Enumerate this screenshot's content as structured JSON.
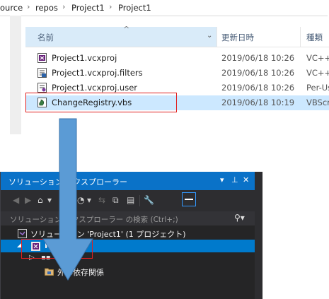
{
  "explorer": {
    "breadcrumb": [
      "ource",
      "repos",
      "Project1",
      "Project1"
    ],
    "columns": {
      "name": "名前",
      "date": "更新日時",
      "type": "種類"
    },
    "files": [
      {
        "name": "Project1.vcxproj",
        "date": "2019/06/18 10:26",
        "type": "VC++",
        "icon": "vcxproj-file-icon"
      },
      {
        "name": "Project1.vcxproj.filters",
        "date": "2019/06/18 10:26",
        "type": "VC++",
        "icon": "filters-file-icon"
      },
      {
        "name": "Project1.vcxproj.user",
        "date": "2019/06/18 10:26",
        "type": "Per-Us",
        "icon": "user-file-icon"
      },
      {
        "name": "ChangeRegistry.vbs",
        "date": "2019/06/18 10:19",
        "type": "VBScri",
        "icon": "vbs-script-icon"
      }
    ]
  },
  "vs": {
    "title": "ソリューション エクスプローラー",
    "search_placeholder": "ソリューション エクスプローラー の検索 (Ctrl+;)",
    "tree": {
      "solution": "ソリューション 'Project1' (1 プロジェクト)",
      "project": "Project1",
      "references": "参照",
      "external_deps": "外部依存関係"
    }
  },
  "colors": {
    "vs_title_blue": "#0a72c8",
    "vs_bg": "#252526",
    "selection_blue": "#007acc",
    "highlight_red": "#e02020",
    "arrow_blue": "#5b9bd5",
    "explorer_selection": "#cce8ff"
  }
}
